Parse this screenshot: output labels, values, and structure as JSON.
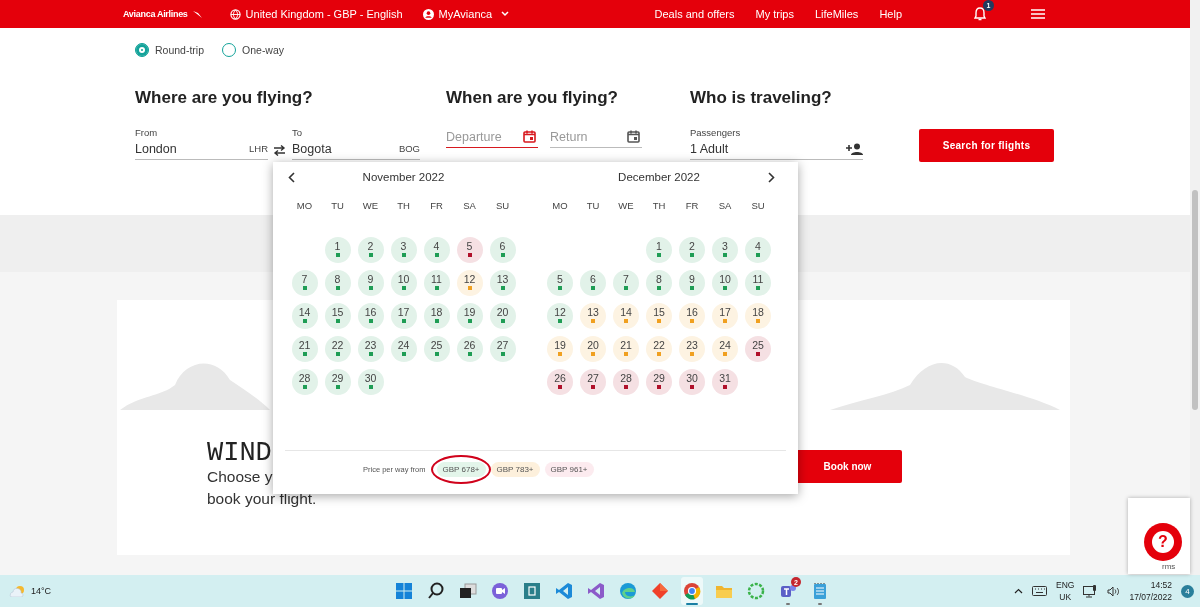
{
  "header": {
    "logo": "Avianca Airlines",
    "region": "United Kingdom - GBP - English",
    "account": "MyAvianca",
    "links": [
      "Deals and offers",
      "My trips",
      "LifeMiles",
      "Help"
    ],
    "notification_count": "1"
  },
  "trip_types": [
    {
      "label": "Round-trip",
      "selected": true
    },
    {
      "label": "One-way",
      "selected": false
    }
  ],
  "sections": [
    "Where are you flying?",
    "When are you flying?",
    "Who is traveling?"
  ],
  "from": {
    "label": "From",
    "value": "London",
    "code": "LHR"
  },
  "to": {
    "label": "To",
    "value": "Bogota",
    "code": "BOG"
  },
  "departure": {
    "placeholder": "Departure",
    "focused": true
  },
  "return": {
    "placeholder": "Return",
    "focused": false
  },
  "passengers": {
    "label": "Passengers",
    "value": "1 Adult"
  },
  "search_button": "Search for flights",
  "calendar": {
    "months": [
      {
        "title": "November 2022",
        "weekdays": [
          "MO",
          "TU",
          "WE",
          "TH",
          "FR",
          "SA",
          "SU"
        ],
        "weeks": [
          [
            {
              "label": "1",
              "color": "#1f9d55"
            },
            {
              "label": "2",
              "color": "#1f9d55"
            },
            {
              "label": "3",
              "color": "#1f9d55"
            },
            {
              "label": "4",
              "color": "#1f9d55"
            },
            {
              "label": "5",
              "color": "#b0102a"
            },
            {
              "label": "6",
              "color": "#1f9d55"
            }
          ],
          [
            {
              "label": "7",
              "color": "#1f9d55"
            },
            {
              "label": "8",
              "color": "#1f9d55"
            },
            {
              "label": "9",
              "color": "#1f9d55"
            },
            {
              "label": "10",
              "color": "#1f9d55"
            },
            {
              "label": "11",
              "color": "#1f9d55"
            },
            {
              "label": "12",
              "color": "#f0a020"
            },
            {
              "label": "13",
              "color": "#1f9d55"
            }
          ],
          [
            {
              "label": "14",
              "color": "#1f9d55"
            },
            {
              "label": "15",
              "color": "#1f9d55"
            },
            {
              "label": "16",
              "color": "#1f9d55"
            },
            {
              "label": "17",
              "color": "#1f9d55"
            },
            {
              "label": "18",
              "color": "#1f9d55"
            },
            {
              "label": "19",
              "color": "#1f9d55"
            },
            {
              "label": "20",
              "color": "#1f9d55"
            }
          ],
          [
            {
              "label": "21",
              "color": "#1f9d55"
            },
            {
              "label": "22",
              "color": "#1f9d55"
            },
            {
              "label": "23",
              "color": "#1f9d55"
            },
            {
              "label": "24",
              "color": "#1f9d55"
            },
            {
              "label": "25",
              "color": "#1f9d55"
            },
            {
              "label": "26",
              "color": "#1f9d55"
            },
            {
              "label": "27",
              "color": "#1f9d55"
            }
          ],
          [
            {
              "label": "28",
              "color": "#1f9d55"
            },
            {
              "label": "29",
              "color": "#1f9d55"
            },
            {
              "label": "30",
              "color": "#1f9d55"
            }
          ]
        ]
      },
      {
        "title": "December 2022",
        "weekdays": [
          "MO",
          "TU",
          "WE",
          "TH",
          "FR",
          "SA",
          "SU"
        ],
        "weeks": [
          [
            {
              "label": "1",
              "color": "#1f9d55"
            },
            {
              "label": "2",
              "color": "#1f9d55"
            },
            {
              "label": "3",
              "color": "#1f9d55"
            },
            {
              "label": "4",
              "color": "#1f9d55"
            }
          ],
          [
            {
              "label": "5",
              "color": "#1f9d55"
            },
            {
              "label": "6",
              "color": "#1f9d55"
            },
            {
              "label": "7",
              "color": "#1f9d55"
            },
            {
              "label": "8",
              "color": "#1f9d55"
            },
            {
              "label": "9",
              "color": "#1f9d55"
            },
            {
              "label": "10",
              "color": "#1f9d55"
            },
            {
              "label": "11",
              "color": "#1f9d55"
            }
          ],
          [
            {
              "label": "12",
              "color": "#1f9d55"
            },
            {
              "label": "13",
              "color": "#f0a020"
            },
            {
              "label": "14",
              "color": "#f0a020"
            },
            {
              "label": "15",
              "color": "#f0a020"
            },
            {
              "label": "16",
              "color": "#f0a020"
            },
            {
              "label": "17",
              "color": "#f0a020"
            },
            {
              "label": "18",
              "color": "#f0a020"
            }
          ],
          [
            {
              "label": "19",
              "color": "#f0a020"
            },
            {
              "label": "20",
              "color": "#f0a020"
            },
            {
              "label": "21",
              "color": "#f0a020"
            },
            {
              "label": "22",
              "color": "#f0a020"
            },
            {
              "label": "23",
              "color": "#f0a020"
            },
            {
              "label": "24",
              "color": "#f0a020"
            },
            {
              "label": "25",
              "color": "#b0102a"
            }
          ],
          [
            {
              "label": "26",
              "color": "#b0102a"
            },
            {
              "label": "27",
              "color": "#b0102a"
            },
            {
              "label": "28",
              "color": "#b0102a"
            },
            {
              "label": "29",
              "color": "#b0102a"
            },
            {
              "label": "30",
              "color": "#b0102a"
            },
            {
              "label": "31",
              "color": "#b0102a"
            }
          ]
        ]
      }
    ],
    "legend_label": "Price per way from",
    "legend": [
      {
        "label": "GBP 678+",
        "color": "#e3f5ea",
        "circled": true
      },
      {
        "label": "GBP 783+",
        "color": "#fdf0dc",
        "circled": false
      },
      {
        "label": "GBP 961+",
        "color": "#fcebef",
        "circled": false
      }
    ]
  },
  "promo": {
    "title": "WIND",
    "lines": [
      "Choose y",
      "book your flight."
    ],
    "button": "Book now"
  },
  "help": {
    "label": "?",
    "recaptcha_text": "rms"
  },
  "taskbar": {
    "weather": "14°C",
    "apps": [
      {
        "kind": "start",
        "active": false,
        "running": false
      },
      {
        "kind": "search",
        "active": false,
        "running": false
      },
      {
        "kind": "taskview",
        "active": false,
        "running": false
      },
      {
        "kind": "meet",
        "active": false,
        "running": false
      },
      {
        "kind": "fi",
        "active": false,
        "running": false
      },
      {
        "kind": "vscode",
        "active": false,
        "running": false
      },
      {
        "kind": "vs",
        "active": false,
        "running": false
      },
      {
        "kind": "edge",
        "active": false,
        "running": false
      },
      {
        "kind": "diamond",
        "active": false,
        "running": false
      },
      {
        "kind": "chrome",
        "active": true,
        "running": true
      },
      {
        "kind": "files",
        "active": false,
        "running": false
      },
      {
        "kind": "ring",
        "active": false,
        "running": false
      },
      {
        "kind": "teams",
        "active": false,
        "running": true,
        "badge": "2"
      },
      {
        "kind": "notepad",
        "active": false,
        "running": true
      }
    ],
    "language": [
      "ENG",
      "UK"
    ],
    "time": "14:52",
    "date": "17/07/2022",
    "notifications": "4"
  }
}
